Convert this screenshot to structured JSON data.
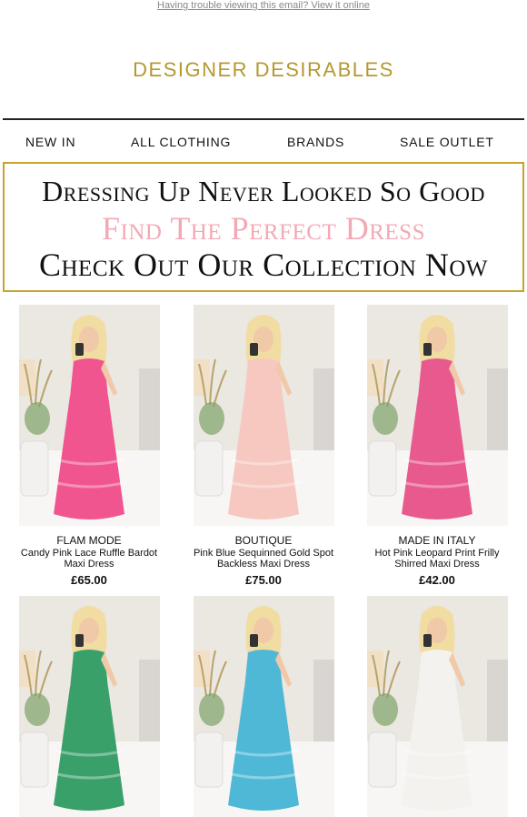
{
  "header": {
    "view_online": "Having trouble viewing this email? View it online",
    "brand": "DESIGNER DESIRABLES"
  },
  "nav": [
    "NEW IN",
    "ALL CLOTHING",
    "BRANDS",
    "SALE OUTLET"
  ],
  "banner": {
    "line1": "Dressing Up Never Looked So Good",
    "line2": "Find The Perfect Dress",
    "line3": "Check Out Our Collection Now"
  },
  "colors": {
    "brand_gold": "#b5982e",
    "banner_border": "#c9a227",
    "banner_pink": "#f2a9b5"
  },
  "products": [
    {
      "brand": "FLAM MODE",
      "name": "Candy Pink Lace Ruffle Bardot Maxi Dress",
      "price": "£65.00",
      "dress_color": "#f0558f",
      "icon": "pink-ruffle-dress-photo"
    },
    {
      "brand": "BOUTIQUE",
      "name": "Pink Blue Sequinned Gold Spot Backless Maxi Dress",
      "price": "£75.00",
      "dress_color": "#f6c8c0",
      "icon": "pink-blue-dress-photo"
    },
    {
      "brand": "MADE IN ITALY",
      "name": "Hot Pink Leopard Print Frilly Shirred Maxi Dress",
      "price": "£42.00",
      "dress_color": "#e85a8e",
      "icon": "leopard-dress-photo"
    },
    {
      "brand": "",
      "name": "",
      "price": "",
      "dress_color": "#3aa06a",
      "icon": "green-print-dress-photo"
    },
    {
      "brand": "",
      "name": "",
      "price": "",
      "dress_color": "#4fb8d6",
      "icon": "blue-dress-photo"
    },
    {
      "brand": "",
      "name": "",
      "price": "",
      "dress_color": "#f4f2ee",
      "icon": "white-dress-photo"
    }
  ]
}
